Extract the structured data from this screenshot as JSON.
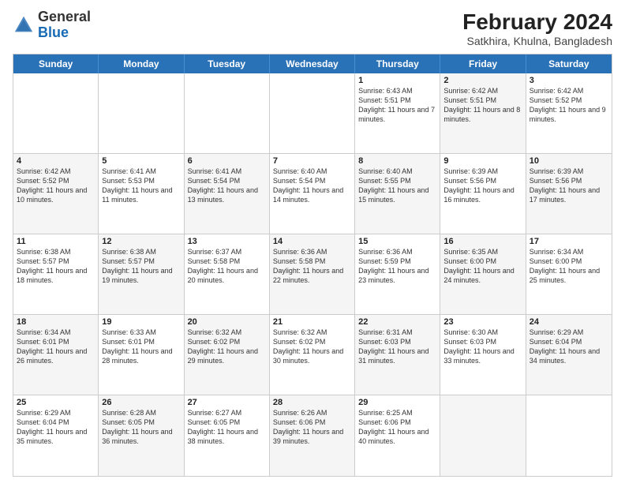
{
  "header": {
    "logo_general": "General",
    "logo_blue": "Blue",
    "month_year": "February 2024",
    "location": "Satkhira, Khulna, Bangladesh"
  },
  "days_of_week": [
    "Sunday",
    "Monday",
    "Tuesday",
    "Wednesday",
    "Thursday",
    "Friday",
    "Saturday"
  ],
  "weeks": [
    [
      {
        "day": "",
        "sunrise": "",
        "sunset": "",
        "daylight": "",
        "shaded": false
      },
      {
        "day": "",
        "sunrise": "",
        "sunset": "",
        "daylight": "",
        "shaded": false
      },
      {
        "day": "",
        "sunrise": "",
        "sunset": "",
        "daylight": "",
        "shaded": false
      },
      {
        "day": "",
        "sunrise": "",
        "sunset": "",
        "daylight": "",
        "shaded": false
      },
      {
        "day": "1",
        "sunrise": "Sunrise: 6:43 AM",
        "sunset": "Sunset: 5:51 PM",
        "daylight": "Daylight: 11 hours and 7 minutes.",
        "shaded": false
      },
      {
        "day": "2",
        "sunrise": "Sunrise: 6:42 AM",
        "sunset": "Sunset: 5:51 PM",
        "daylight": "Daylight: 11 hours and 8 minutes.",
        "shaded": true
      },
      {
        "day": "3",
        "sunrise": "Sunrise: 6:42 AM",
        "sunset": "Sunset: 5:52 PM",
        "daylight": "Daylight: 11 hours and 9 minutes.",
        "shaded": false
      }
    ],
    [
      {
        "day": "4",
        "sunrise": "Sunrise: 6:42 AM",
        "sunset": "Sunset: 5:52 PM",
        "daylight": "Daylight: 11 hours and 10 minutes.",
        "shaded": true
      },
      {
        "day": "5",
        "sunrise": "Sunrise: 6:41 AM",
        "sunset": "Sunset: 5:53 PM",
        "daylight": "Daylight: 11 hours and 11 minutes.",
        "shaded": false
      },
      {
        "day": "6",
        "sunrise": "Sunrise: 6:41 AM",
        "sunset": "Sunset: 5:54 PM",
        "daylight": "Daylight: 11 hours and 13 minutes.",
        "shaded": true
      },
      {
        "day": "7",
        "sunrise": "Sunrise: 6:40 AM",
        "sunset": "Sunset: 5:54 PM",
        "daylight": "Daylight: 11 hours and 14 minutes.",
        "shaded": false
      },
      {
        "day": "8",
        "sunrise": "Sunrise: 6:40 AM",
        "sunset": "Sunset: 5:55 PM",
        "daylight": "Daylight: 11 hours and 15 minutes.",
        "shaded": true
      },
      {
        "day": "9",
        "sunrise": "Sunrise: 6:39 AM",
        "sunset": "Sunset: 5:56 PM",
        "daylight": "Daylight: 11 hours and 16 minutes.",
        "shaded": false
      },
      {
        "day": "10",
        "sunrise": "Sunrise: 6:39 AM",
        "sunset": "Sunset: 5:56 PM",
        "daylight": "Daylight: 11 hours and 17 minutes.",
        "shaded": true
      }
    ],
    [
      {
        "day": "11",
        "sunrise": "Sunrise: 6:38 AM",
        "sunset": "Sunset: 5:57 PM",
        "daylight": "Daylight: 11 hours and 18 minutes.",
        "shaded": false
      },
      {
        "day": "12",
        "sunrise": "Sunrise: 6:38 AM",
        "sunset": "Sunset: 5:57 PM",
        "daylight": "Daylight: 11 hours and 19 minutes.",
        "shaded": true
      },
      {
        "day": "13",
        "sunrise": "Sunrise: 6:37 AM",
        "sunset": "Sunset: 5:58 PM",
        "daylight": "Daylight: 11 hours and 20 minutes.",
        "shaded": false
      },
      {
        "day": "14",
        "sunrise": "Sunrise: 6:36 AM",
        "sunset": "Sunset: 5:58 PM",
        "daylight": "Daylight: 11 hours and 22 minutes.",
        "shaded": true
      },
      {
        "day": "15",
        "sunrise": "Sunrise: 6:36 AM",
        "sunset": "Sunset: 5:59 PM",
        "daylight": "Daylight: 11 hours and 23 minutes.",
        "shaded": false
      },
      {
        "day": "16",
        "sunrise": "Sunrise: 6:35 AM",
        "sunset": "Sunset: 6:00 PM",
        "daylight": "Daylight: 11 hours and 24 minutes.",
        "shaded": true
      },
      {
        "day": "17",
        "sunrise": "Sunrise: 6:34 AM",
        "sunset": "Sunset: 6:00 PM",
        "daylight": "Daylight: 11 hours and 25 minutes.",
        "shaded": false
      }
    ],
    [
      {
        "day": "18",
        "sunrise": "Sunrise: 6:34 AM",
        "sunset": "Sunset: 6:01 PM",
        "daylight": "Daylight: 11 hours and 26 minutes.",
        "shaded": true
      },
      {
        "day": "19",
        "sunrise": "Sunrise: 6:33 AM",
        "sunset": "Sunset: 6:01 PM",
        "daylight": "Daylight: 11 hours and 28 minutes.",
        "shaded": false
      },
      {
        "day": "20",
        "sunrise": "Sunrise: 6:32 AM",
        "sunset": "Sunset: 6:02 PM",
        "daylight": "Daylight: 11 hours and 29 minutes.",
        "shaded": true
      },
      {
        "day": "21",
        "sunrise": "Sunrise: 6:32 AM",
        "sunset": "Sunset: 6:02 PM",
        "daylight": "Daylight: 11 hours and 30 minutes.",
        "shaded": false
      },
      {
        "day": "22",
        "sunrise": "Sunrise: 6:31 AM",
        "sunset": "Sunset: 6:03 PM",
        "daylight": "Daylight: 11 hours and 31 minutes.",
        "shaded": true
      },
      {
        "day": "23",
        "sunrise": "Sunrise: 6:30 AM",
        "sunset": "Sunset: 6:03 PM",
        "daylight": "Daylight: 11 hours and 33 minutes.",
        "shaded": false
      },
      {
        "day": "24",
        "sunrise": "Sunrise: 6:29 AM",
        "sunset": "Sunset: 6:04 PM",
        "daylight": "Daylight: 11 hours and 34 minutes.",
        "shaded": true
      }
    ],
    [
      {
        "day": "25",
        "sunrise": "Sunrise: 6:29 AM",
        "sunset": "Sunset: 6:04 PM",
        "daylight": "Daylight: 11 hours and 35 minutes.",
        "shaded": false
      },
      {
        "day": "26",
        "sunrise": "Sunrise: 6:28 AM",
        "sunset": "Sunset: 6:05 PM",
        "daylight": "Daylight: 11 hours and 36 minutes.",
        "shaded": true
      },
      {
        "day": "27",
        "sunrise": "Sunrise: 6:27 AM",
        "sunset": "Sunset: 6:05 PM",
        "daylight": "Daylight: 11 hours and 38 minutes.",
        "shaded": false
      },
      {
        "day": "28",
        "sunrise": "Sunrise: 6:26 AM",
        "sunset": "Sunset: 6:06 PM",
        "daylight": "Daylight: 11 hours and 39 minutes.",
        "shaded": true
      },
      {
        "day": "29",
        "sunrise": "Sunrise: 6:25 AM",
        "sunset": "Sunset: 6:06 PM",
        "daylight": "Daylight: 11 hours and 40 minutes.",
        "shaded": false
      },
      {
        "day": "",
        "sunrise": "",
        "sunset": "",
        "daylight": "",
        "shaded": true
      },
      {
        "day": "",
        "sunrise": "",
        "sunset": "",
        "daylight": "",
        "shaded": false
      }
    ]
  ]
}
